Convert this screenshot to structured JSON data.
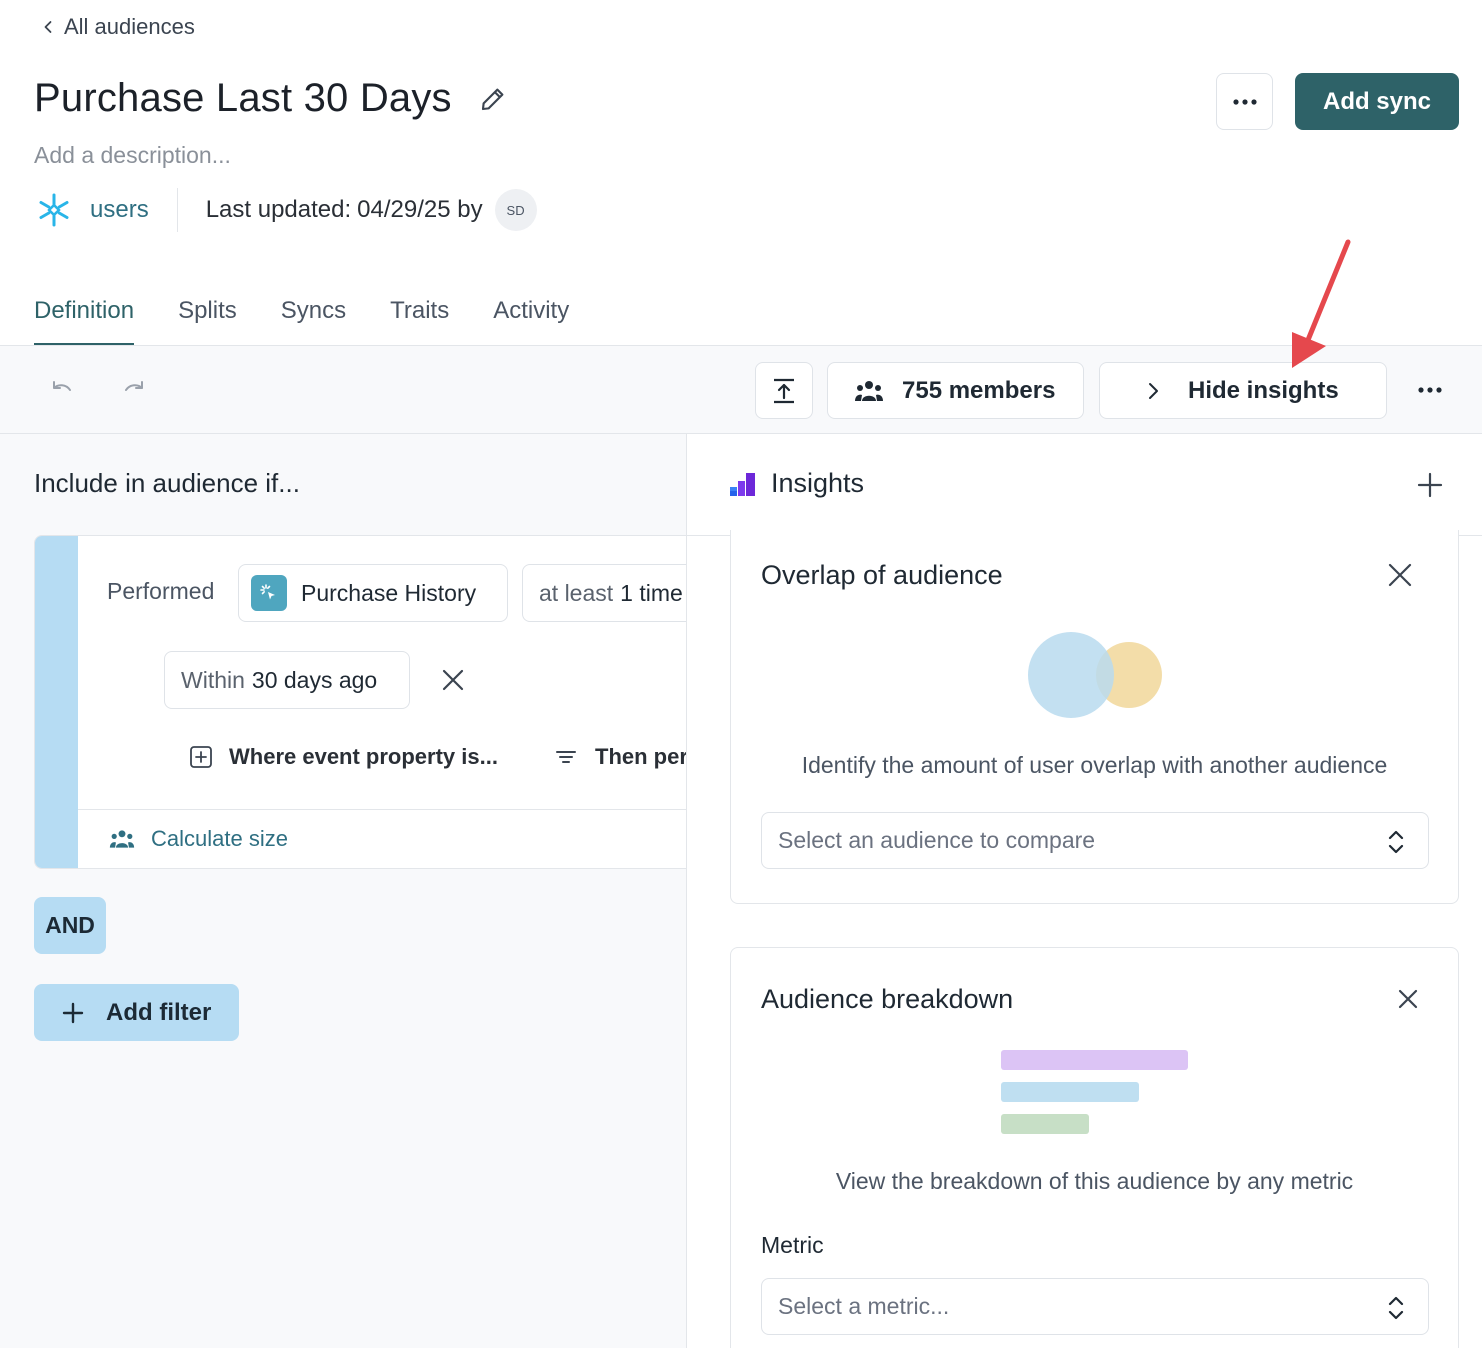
{
  "header": {
    "back_label": "All audiences",
    "title": "Purchase Last 30 Days",
    "description_placeholder": "Add a description...",
    "source_name": "users",
    "last_updated_label": "Last updated:",
    "last_updated_value": "04/29/25 by",
    "avatar_initials": "SD",
    "add_sync_label": "Add sync",
    "more_icon": "ellipsis-icon"
  },
  "tabs": [
    {
      "label": "Definition",
      "active": true
    },
    {
      "label": "Splits",
      "active": false
    },
    {
      "label": "Syncs",
      "active": false
    },
    {
      "label": "Traits",
      "active": false
    },
    {
      "label": "Activity",
      "active": false
    }
  ],
  "toolbar": {
    "members_label": "755 members",
    "insights_label": "Hide insights"
  },
  "definition": {
    "heading": "Include in audience if...",
    "performed_label": "Performed",
    "event_name": "Purchase History",
    "frequency_prefix": "at least",
    "frequency_value": "1 time",
    "within_prefix": "Within",
    "within_value": "30 days ago",
    "where_label": "Where event property is...",
    "then_label": "Then performed",
    "calculate_label": "Calculate size",
    "and_label": "AND",
    "add_filter_label": "Add filter"
  },
  "insights": {
    "title": "Insights",
    "overlap": {
      "title": "Overlap of audience",
      "description": "Identify the amount of user overlap with another audience",
      "select_placeholder": "Select an audience to compare"
    },
    "breakdown": {
      "title": "Audience breakdown",
      "description": "View the breakdown of this audience by any metric",
      "metric_label": "Metric",
      "select_placeholder": "Select a metric..."
    }
  },
  "colors": {
    "accent": "#2e6268",
    "link": "#2f6f82",
    "condition_stripe": "#b6dcf3",
    "annotation_arrow": "#e5484d"
  }
}
